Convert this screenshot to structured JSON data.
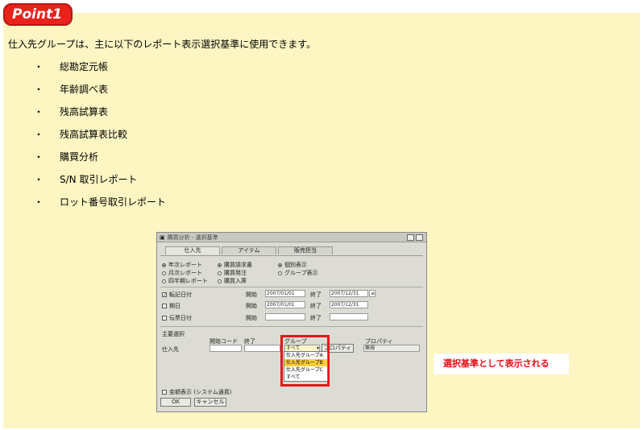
{
  "badge": {
    "label": "Point1"
  },
  "intro": "仕入先グループは、主に以下のレポート表示選択基準に使用できます。",
  "bullets": [
    {
      "mark": "・",
      "label": "総勘定元帳"
    },
    {
      "mark": "・",
      "label": "年齢調べ表"
    },
    {
      "mark": "・",
      "label": "残高試算表"
    },
    {
      "mark": "・",
      "label": "残高試算表比較"
    },
    {
      "mark": "・",
      "label": "購買分析"
    },
    {
      "mark": "・",
      "label": "S/N 取引レポート"
    },
    {
      "mark": "・",
      "label": "ロット番号取引レポート"
    }
  ],
  "dialog": {
    "title": "購買分析 - 選択基準",
    "tabs": [
      "仕入先",
      "アイテム",
      "販売担当"
    ],
    "radios_col1": [
      "年次レポート",
      "月次レポート",
      "四半期レポート"
    ],
    "radios_col2": [
      "購買請求書",
      "購買発注",
      "購買入庫"
    ],
    "radios_col3": [
      "個別表示",
      "グループ表示"
    ],
    "date_rows": [
      {
        "label": "転記日付",
        "checked": true,
        "from_label": "開始",
        "from": "2007/01/01",
        "to_label": "終了",
        "to": "2007/12/31"
      },
      {
        "label": "期日",
        "checked": false,
        "from_label": "開始",
        "from": "2007/01/01",
        "to_label": "終了",
        "to": "2007/12/31"
      },
      {
        "label": "伝票日付",
        "checked": false,
        "from_label": "開始",
        "from": "",
        "to_label": "終了",
        "to": ""
      }
    ],
    "main_criteria": "主要選択",
    "col_code_from": "開始コード",
    "col_code_to": "終了",
    "col_group": "グループ",
    "col_property": "プロパティ",
    "row_vendor": "仕入先",
    "group_value": "すべて",
    "property_button": "プロパティ",
    "property_value": "無視",
    "dropdown_options": [
      "仕入先グループA",
      "仕入先グループB",
      "仕入先グループC",
      "すべて"
    ],
    "dropdown_selected": 1,
    "amount_display": "金額表示 (システム通貨)",
    "ok": "OK",
    "cancel": "キャンセル"
  },
  "callout": "選択基準として表示される",
  "colors": {
    "badge": "#e8221b",
    "panel": "#fdf6c3",
    "highlight": "#e4161b"
  }
}
